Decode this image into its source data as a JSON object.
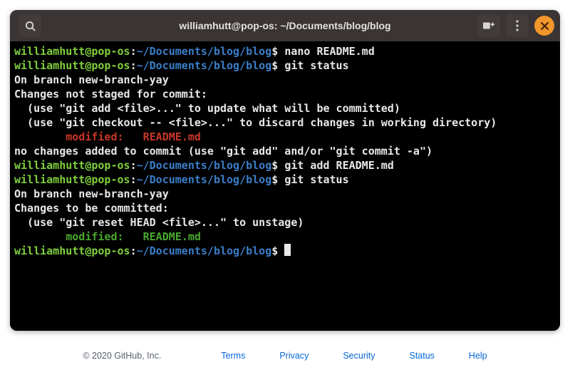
{
  "window": {
    "title": "williamhutt@pop-os: ~/Documents/blog/blog",
    "icons": {
      "search": "search-icon",
      "newtab": "new-tab-icon",
      "menu": "kebab-menu-icon",
      "close": "close-icon"
    }
  },
  "prompt": {
    "user": "williamhutt@pop-os",
    "sep": ":",
    "path": "~/Documents/blog/blog",
    "dollar": "$ "
  },
  "lines": [
    {
      "type": "prompt",
      "cmd": "nano README.md"
    },
    {
      "type": "prompt",
      "cmd": "git status"
    },
    {
      "type": "plain",
      "text": "On branch new-branch-yay"
    },
    {
      "type": "plain",
      "text": "Changes not staged for commit:"
    },
    {
      "type": "plain",
      "text": "  (use \"git add <file>...\" to update what will be committed)"
    },
    {
      "type": "plain",
      "text": "  (use \"git checkout -- <file>...\" to discard changes in working directory)"
    },
    {
      "type": "plain",
      "text": ""
    },
    {
      "type": "red",
      "text": "        modified:   README.md"
    },
    {
      "type": "plain",
      "text": ""
    },
    {
      "type": "plain",
      "text": "no changes added to commit (use \"git add\" and/or \"git commit -a\")"
    },
    {
      "type": "prompt",
      "cmd": "git add README.md"
    },
    {
      "type": "prompt",
      "cmd": "git status"
    },
    {
      "type": "plain",
      "text": "On branch new-branch-yay"
    },
    {
      "type": "plain",
      "text": "Changes to be committed:"
    },
    {
      "type": "plain",
      "text": "  (use \"git reset HEAD <file>...\" to unstage)"
    },
    {
      "type": "plain",
      "text": ""
    },
    {
      "type": "grn",
      "text": "        modified:   README.md"
    },
    {
      "type": "plain",
      "text": ""
    },
    {
      "type": "prompt-cursor",
      "cmd": ""
    }
  ],
  "footer": {
    "copyright": "© 2020 GitHub, Inc.",
    "links": [
      "Terms",
      "Privacy",
      "Security",
      "Status",
      "Help"
    ]
  }
}
